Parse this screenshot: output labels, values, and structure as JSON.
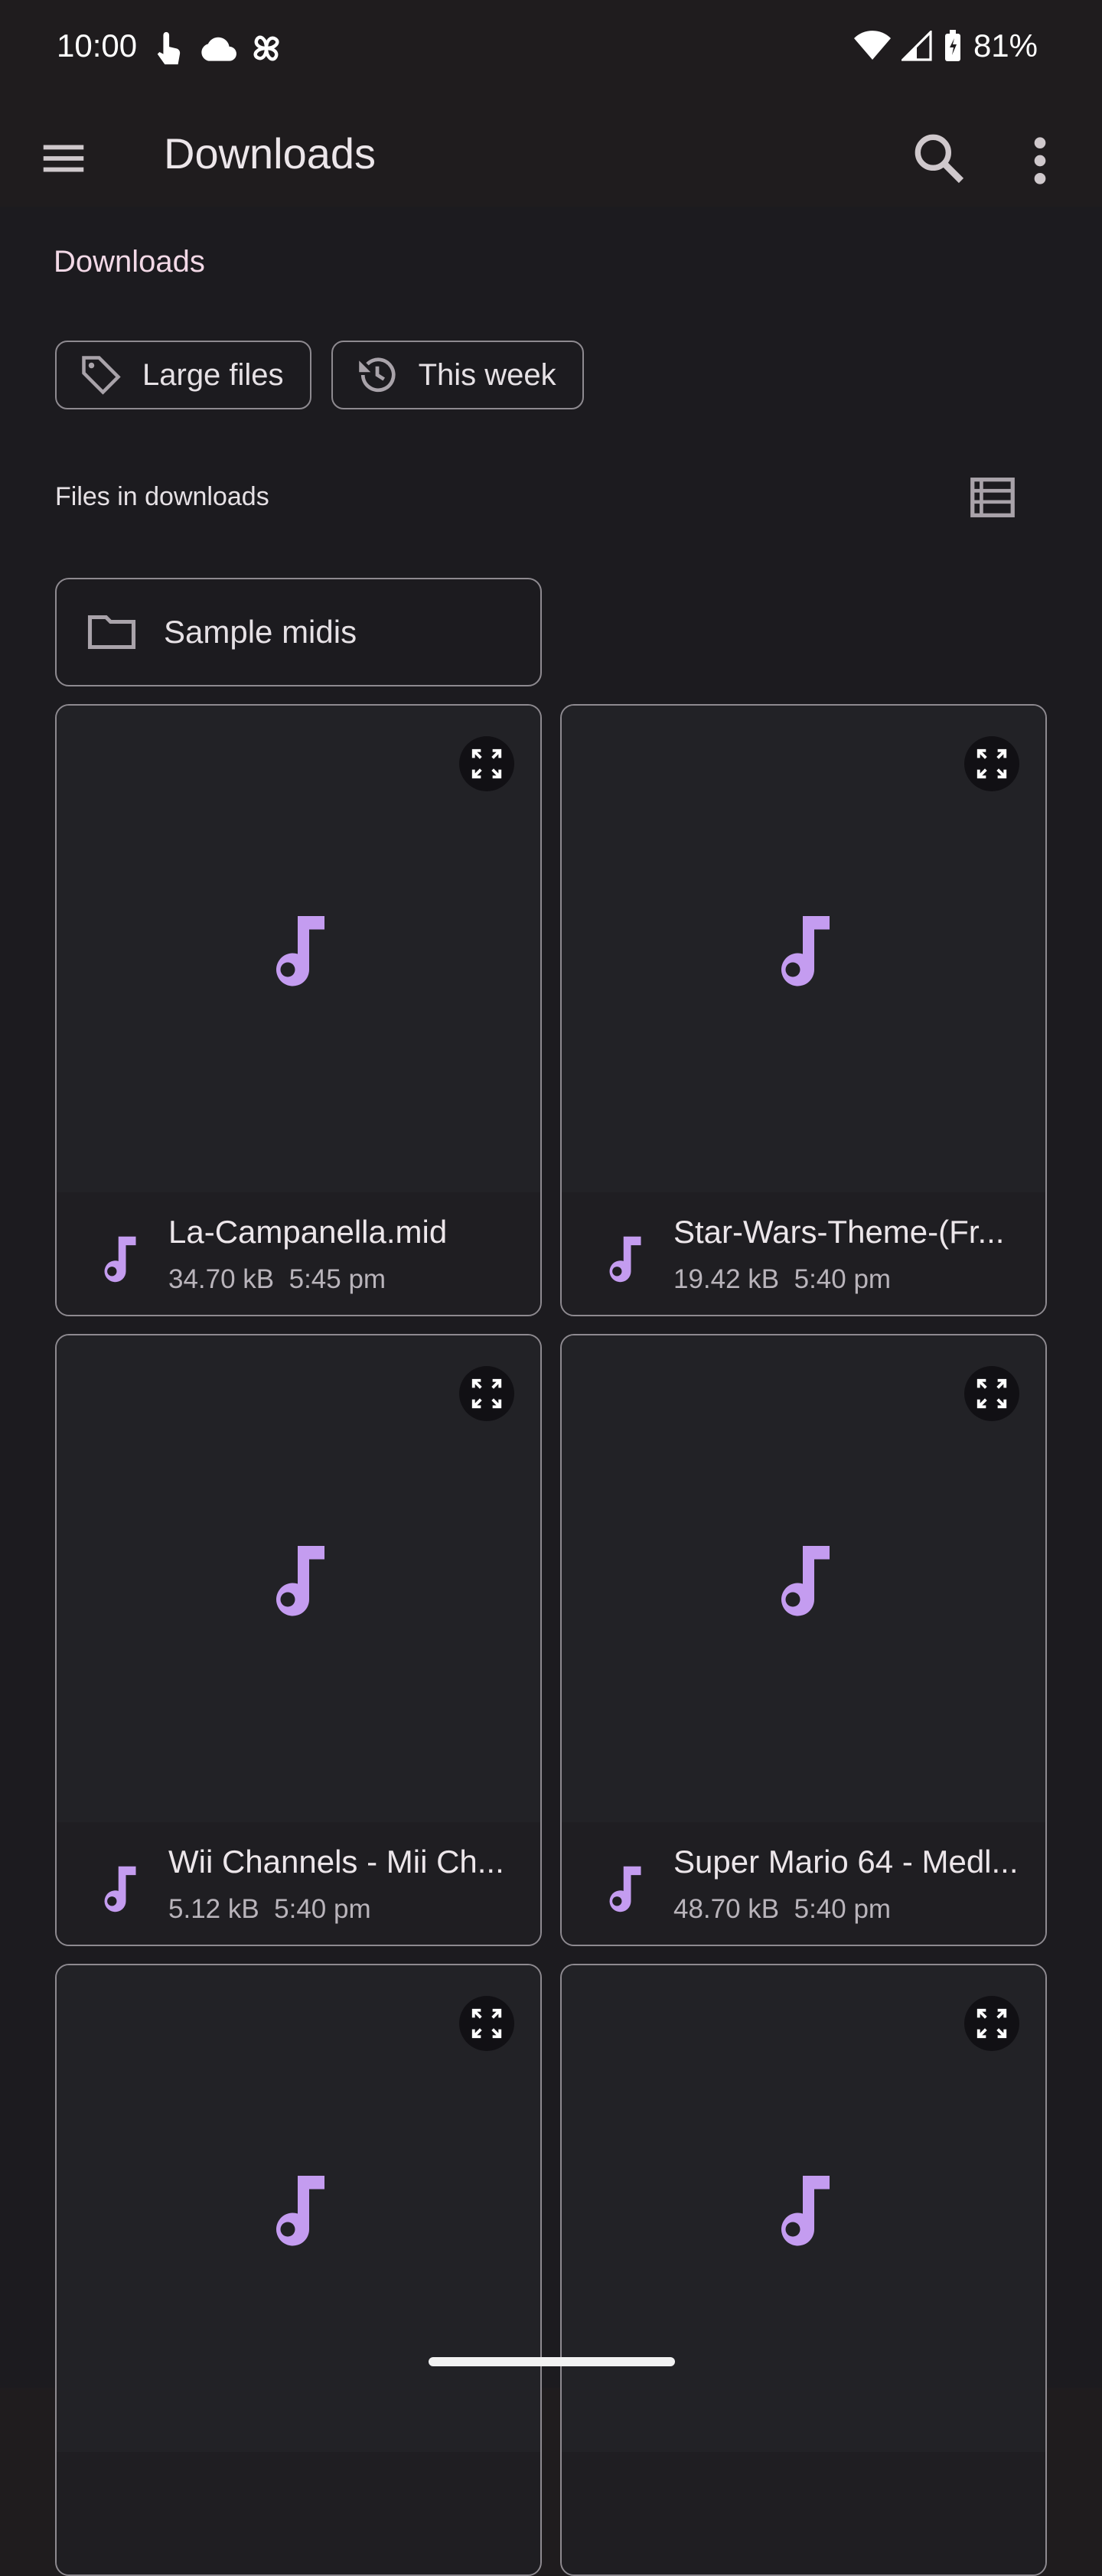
{
  "status_bar": {
    "time": "10:00",
    "battery": "81%",
    "icons_left": [
      "touch-icon",
      "cloud-icon",
      "pinwheel-icon"
    ],
    "icons_right": [
      "wifi-icon",
      "signal-icon",
      "battery-icon"
    ]
  },
  "app_bar": {
    "title": "Downloads",
    "menu_icon": "menu-icon",
    "search_icon": "search-icon",
    "more_icon": "more-vert-icon"
  },
  "breadcrumb": "Downloads",
  "chips": [
    {
      "label": "Large files",
      "icon": "tag-icon"
    },
    {
      "label": "This week",
      "icon": "history-icon"
    }
  ],
  "files_header": "Files in downloads",
  "folder": {
    "name": "Sample midis",
    "icon": "folder-icon"
  },
  "files": [
    {
      "name": "La-Campanella.mid",
      "size": "34.70 kB",
      "time": "5:45 pm"
    },
    {
      "name": "Star-Wars-Theme-(Fr...",
      "size": "19.42 kB",
      "time": "5:40 pm"
    },
    {
      "name": "Wii Channels - Mii Ch...",
      "size": "5.12 kB",
      "time": "5:40 pm"
    },
    {
      "name": "Super Mario 64 - Medl...",
      "size": "48.70 kB",
      "time": "5:40 pm"
    },
    {
      "name": "",
      "size": "",
      "time": ""
    },
    {
      "name": "",
      "size": "",
      "time": ""
    }
  ],
  "colors": {
    "accent": "#c49cf0",
    "background": "#1c1b1f",
    "outline": "#8e8a90"
  }
}
